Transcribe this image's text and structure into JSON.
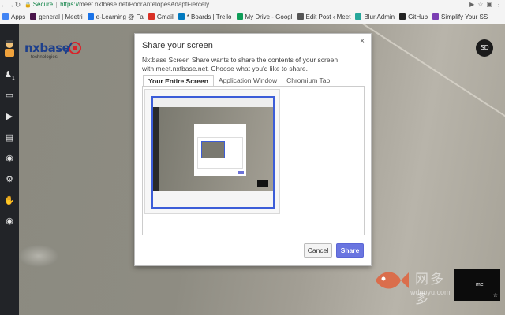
{
  "browser": {
    "secure_label": "Secure",
    "url_scheme": "https://",
    "url_host": "meet.nxtbase.net",
    "url_path": "/PoorAntelopesAdaptFiercely"
  },
  "bookmarks": [
    {
      "label": "Apps",
      "icon": "apps-grid-icon",
      "color": "#4285f4"
    },
    {
      "label": "general | Meetri",
      "icon": "slack-icon",
      "color": "#4a154b"
    },
    {
      "label": "e-Learning @ Fa",
      "icon": "bookmark-icon",
      "color": "#1a73e8"
    },
    {
      "label": "Gmail",
      "icon": "gmail-icon",
      "color": "#d93025"
    },
    {
      "label": "* Boards | Trello",
      "icon": "trello-icon",
      "color": "#0079bf"
    },
    {
      "label": "My Drive - Googl",
      "icon": "drive-icon",
      "color": "#0f9d58"
    },
    {
      "label": "Edit Post ‹ Meet",
      "icon": "wordpress-icon",
      "color": "#555555"
    },
    {
      "label": "Blur Admin",
      "icon": "chart-icon",
      "color": "#26a69a"
    },
    {
      "label": "GitHub",
      "icon": "github-icon",
      "color": "#222222"
    },
    {
      "label": "Simplify Your SS",
      "icon": "bookmark-icon",
      "color": "#7b3fb3"
    }
  ],
  "logo": {
    "brand": "nxbase",
    "tagline": "technologies"
  },
  "user_avatar_initials": "SD",
  "rail_badge": "1",
  "dialog": {
    "title": "Share your screen",
    "close": "×",
    "description": "Nxtbase Screen Share wants to share the contents of your screen with meet.nxtbase.net. Choose what you'd like to share.",
    "tabs": [
      "Your Entire Screen",
      "Application Window",
      "Chromium Tab"
    ],
    "active_tab": 0,
    "cancel_label": "Cancel",
    "share_label": "Share"
  },
  "self_view_label": "me",
  "watermark": {
    "text": "网多多",
    "url": "wduoyu.com"
  },
  "colors": {
    "accent": "#6a75e0",
    "thumb_border": "#3c5dd8",
    "brand": "#1d3f8c",
    "rail": "#222428"
  }
}
